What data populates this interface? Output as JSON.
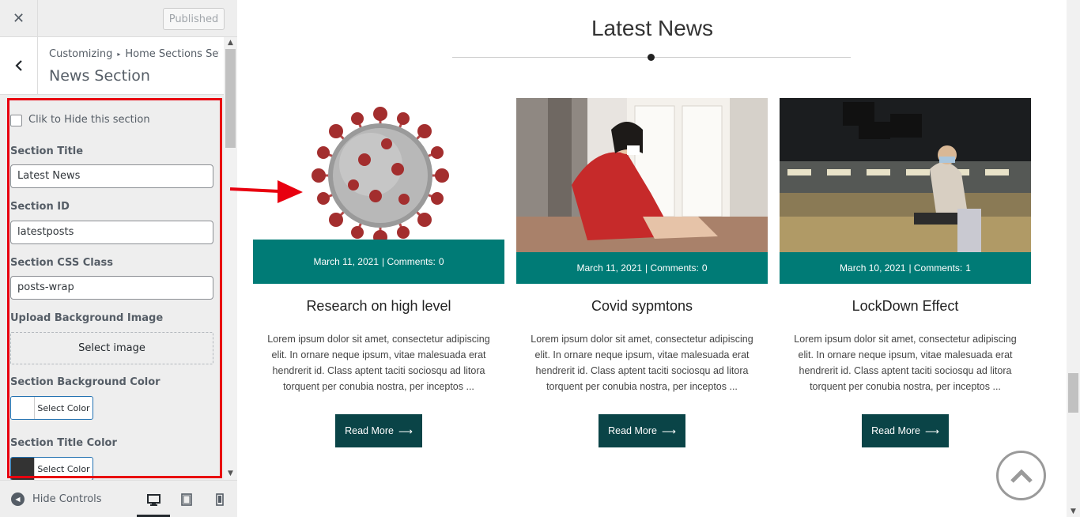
{
  "topbar": {
    "close_icon": "close-icon",
    "published_label": "Published"
  },
  "section_header": {
    "breadcrumb_root": "Customizing",
    "breadcrumb_sep": "▸",
    "breadcrumb_parent": "Home Sections Set...",
    "title": "News Section"
  },
  "controls": {
    "hide_label": "Clik to Hide this section",
    "section_title_label": "Section Title",
    "section_title_value": "Latest News",
    "section_id_label": "Section ID",
    "section_id_value": "latestposts",
    "section_css_label": "Section CSS Class",
    "section_css_value": "posts-wrap",
    "bg_image_label": "Upload Background Image",
    "select_image_label": "Select image",
    "bg_color_label": "Section Background Color",
    "bg_color_button": "Select Color",
    "bg_color_value": "#ffffff",
    "title_color_label": "Section Title Color",
    "title_color_button": "Select Color",
    "title_color_value": "#333333"
  },
  "footer": {
    "hide_controls_label": "Hide Controls",
    "active_device": "desktop"
  },
  "preview": {
    "heading": "Latest News",
    "cards": [
      {
        "image": "coronavirus-illustration",
        "date": "March 11, 2021",
        "comments_label": "| Comments:",
        "comments_count": "0",
        "title": "Research on high level",
        "excerpt": "Lorem ipsum dolor sit amet, consectetur adipiscing elit. In ornare neque ipsum, vitae malesuada erat hendrerit id. Class aptent taciti sociosqu ad litora torquent per conubia nostra, per inceptos ...",
        "read_more": "Read More"
      },
      {
        "image": "woman-sneezing-photo",
        "date": "March 11, 2021",
        "comments_label": "| Comments:",
        "comments_count": "0",
        "title": "Covid sypmtons",
        "excerpt": "Lorem ipsum dolor sit amet, consectetur adipiscing elit. In ornare neque ipsum, vitae malesuada erat hendrerit id. Class aptent taciti sociosqu ad litora torquent per conubia nostra, per inceptos ...",
        "read_more": "Read More"
      },
      {
        "image": "airport-mask-photo",
        "date": "March 10, 2021",
        "comments_label": "| Comments:",
        "comments_count": "1",
        "title": "LockDown Effect",
        "excerpt": "Lorem ipsum dolor sit amet, consectetur adipiscing elit. In ornare neque ipsum, vitae malesuada erat hendrerit id. Class aptent taciti sociosqu ad litora torquent per conubia nostra, per inceptos ...",
        "read_more": "Read More"
      }
    ]
  },
  "colors": {
    "accent_teal": "#007b76",
    "button_dark": "#0a4447",
    "annotation_red": "#e8000f"
  }
}
